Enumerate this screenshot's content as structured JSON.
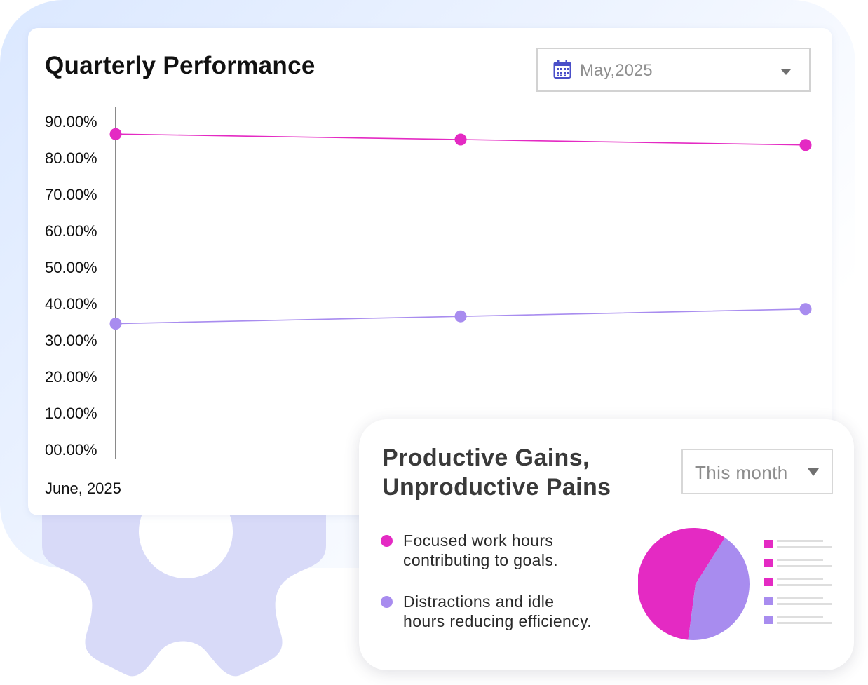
{
  "colors": {
    "magenta": "#e42ac3",
    "lavender": "#a88cef",
    "axis": "#8a8a8a",
    "gear": "#d8daf8"
  },
  "performance_card": {
    "title": "Quarterly Performance",
    "date_select": {
      "icon": "calendar-icon",
      "value": "May,2025"
    },
    "x_caption": "June, 2025"
  },
  "productivity_card": {
    "title_lines": [
      "Productive Gains,",
      "Unproductive Pains"
    ],
    "period_select": {
      "value": "This month"
    },
    "legend": [
      {
        "lines": [
          "Focused work hours",
          "contributing to goals."
        ],
        "color": "#e42ac3"
      },
      {
        "lines": [
          "Distractions and idle",
          "hours reducing efficiency."
        ],
        "color": "#a88cef"
      }
    ],
    "mini_legend_colors": [
      "#e42ac3",
      "#e42ac3",
      "#e42ac3",
      "#a88cef",
      "#a88cef"
    ]
  },
  "chart_data": [
    {
      "type": "line",
      "title": "Quarterly Performance",
      "ylim": [
        0,
        90
      ],
      "y_ticks": [
        "00.00%",
        "10.00%",
        "20.00%",
        "30.00%",
        "40.00%",
        "50.00%",
        "60.00%",
        "70.00%",
        "80.00%",
        "90.00%"
      ],
      "y_tick_values": [
        0,
        10,
        20,
        30,
        40,
        50,
        60,
        70,
        80,
        90
      ],
      "x_points": 3,
      "grid": false,
      "series": [
        {
          "color": "#e42ac3",
          "values": [
            86.5,
            85.0,
            83.5
          ]
        },
        {
          "color": "#a88cef",
          "values": [
            34.5,
            36.5,
            38.5
          ]
        }
      ]
    },
    {
      "type": "pie",
      "title": "Productive Gains, Unproductive Pains",
      "slices": [
        {
          "label": "Focused work hours contributing to goals.",
          "value": 58,
          "color": "#e42ac3"
        },
        {
          "label": "Distractions and idle hours reducing efficiency.",
          "value": 42,
          "color": "#a88cef"
        }
      ]
    }
  ]
}
